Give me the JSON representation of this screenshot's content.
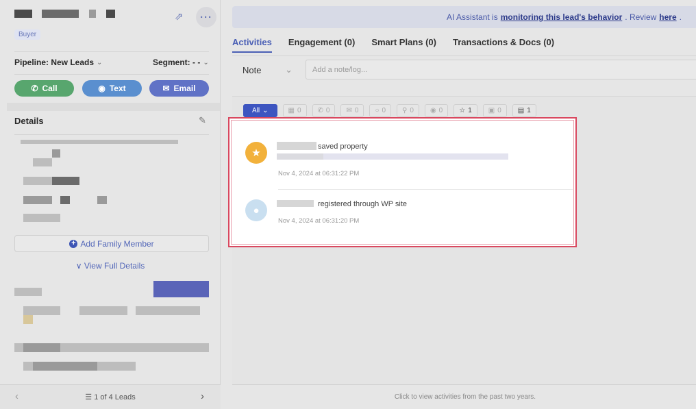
{
  "left": {
    "badge": "Buyer",
    "pipeline_label": "Pipeline: New Leads",
    "segment_label": "Segment: - -",
    "chevron": "⌄",
    "actions": [
      {
        "label": "Call",
        "icon": "phone-icon"
      },
      {
        "label": "Text",
        "icon": "chat-icon"
      },
      {
        "label": "Email",
        "icon": "mail-icon"
      }
    ],
    "details_title": "Details",
    "add_family": "Add Family Member",
    "view_full": "View Full Details",
    "footer": {
      "count": "1 of 4 Leads"
    }
  },
  "right": {
    "banner": {
      "prefix": "AI Assistant is",
      "link": "monitoring this lead's behavior",
      "mid": ". Review",
      "here": "here",
      "end": "."
    },
    "tabs": [
      {
        "label": "Activities",
        "active": true
      },
      {
        "label": "Engagement (0)",
        "active": false
      },
      {
        "label": "Smart Plans (0)",
        "active": false
      },
      {
        "label": "Transactions & Docs (0)",
        "active": false
      }
    ],
    "note": {
      "selected": "Note",
      "placeholder": "Add a note/log..."
    },
    "filters": [
      {
        "label": "All",
        "icon": ""
      },
      {
        "label": "0",
        "icon": "calendar-icon"
      },
      {
        "label": "0",
        "icon": "phone-icon"
      },
      {
        "label": "0",
        "icon": "mail-icon"
      },
      {
        "label": "0",
        "icon": "chat-icon"
      },
      {
        "label": "0",
        "icon": "search-icon"
      },
      {
        "label": "0",
        "icon": "eye-icon"
      },
      {
        "label": "1",
        "icon": "star-icon"
      },
      {
        "label": "0",
        "icon": "briefcase-icon"
      },
      {
        "label": "1",
        "icon": "message-icon"
      }
    ],
    "footer_hint": "Click to view activities from the past two years.",
    "activities": [
      {
        "text": "saved property",
        "date": "Nov 4, 2024 at 06:31:22 PM",
        "icon": "star-icon"
      },
      {
        "text": "registered through WP site",
        "date": "Nov 4, 2024 at 06:31:20 PM",
        "icon": "user-icon"
      }
    ]
  },
  "colors": {
    "accent": "#3d55c0",
    "highlight": "#d9485f",
    "star": "#f2b13b"
  }
}
